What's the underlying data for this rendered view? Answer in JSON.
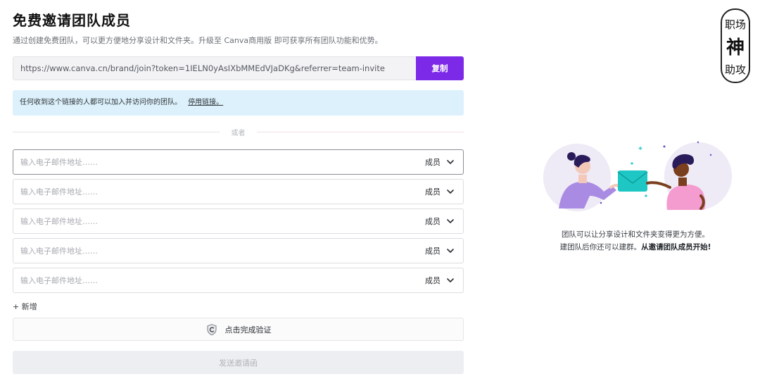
{
  "header": {
    "title": "免费邀请团队成员",
    "subtitle": "通过创建免费团队，可以更方便地分享设计和文件夹。升级至 Canva商用版 即可获享所有团队功能和优势。"
  },
  "invite_link": {
    "url": "https://www.canva.cn/brand/join?token=1IELN0yAsIXbMMEdVJaDKg&referrer=team-invite",
    "copy_label": "复制"
  },
  "notice": {
    "text": "任何收到这个链接的人都可以加入并访问你的团队。",
    "link_label": "停用链接。"
  },
  "divider": {
    "label": "或者"
  },
  "email_rows": [
    {
      "placeholder": "输入电子邮件地址……",
      "role": "成员"
    },
    {
      "placeholder": "输入电子邮件地址……",
      "role": "成员"
    },
    {
      "placeholder": "输入电子邮件地址……",
      "role": "成员"
    },
    {
      "placeholder": "输入电子邮件地址……",
      "role": "成员"
    },
    {
      "placeholder": "输入电子邮件地址……",
      "role": "成员"
    }
  ],
  "add_new": {
    "label": "+ 新增"
  },
  "verify": {
    "label": "点击完成验证"
  },
  "send": {
    "label": "发送邀请函"
  },
  "side": {
    "line1": "团队可以让分享设计和文件夹变得更为方便。",
    "line2_regular": "建团队后你还可以建群。",
    "line2_bold": "从邀请团队成员开始!"
  },
  "watermark": {
    "text": "职场神助攻"
  },
  "colors": {
    "accent": "#7d2ae8",
    "notice_bg": "#dcf1fb",
    "envelope": "#1fc7c4"
  }
}
